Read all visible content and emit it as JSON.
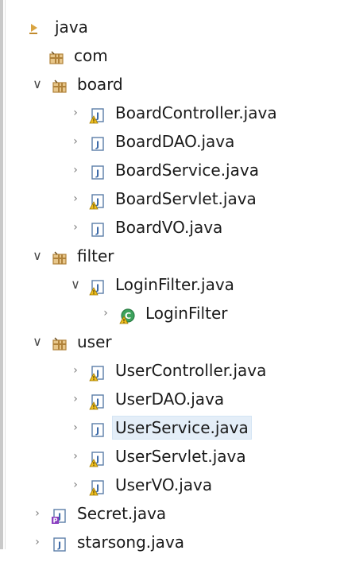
{
  "tree": {
    "items": [
      {
        "label": "java",
        "depth": 0,
        "icon": "source-folder-icon",
        "arrow": "none"
      },
      {
        "label": "com",
        "depth": 1,
        "icon": "package-icon",
        "arrow": "none"
      },
      {
        "label": "board",
        "depth": 2,
        "icon": "package-icon",
        "arrow": "down"
      },
      {
        "label": "BoardController.java",
        "depth": 3,
        "icon": "java-file-warning-icon",
        "arrow": "right"
      },
      {
        "label": "BoardDAO.java",
        "depth": 3,
        "icon": "java-file-icon",
        "arrow": "right"
      },
      {
        "label": "BoardService.java",
        "depth": 3,
        "icon": "java-file-icon",
        "arrow": "right"
      },
      {
        "label": "BoardServlet.java",
        "depth": 3,
        "icon": "java-file-warning-icon",
        "arrow": "right"
      },
      {
        "label": "BoardVO.java",
        "depth": 3,
        "icon": "java-file-icon",
        "arrow": "right"
      },
      {
        "label": "filter",
        "depth": 2,
        "icon": "package-icon",
        "arrow": "down"
      },
      {
        "label": "LoginFilter.java",
        "depth": 3,
        "icon": "java-file-warning-icon",
        "arrow": "down"
      },
      {
        "label": "LoginFilter",
        "depth": 4,
        "icon": "class-icon",
        "arrow": "right"
      },
      {
        "label": "user",
        "depth": 2,
        "icon": "package-icon",
        "arrow": "down"
      },
      {
        "label": "UserController.java",
        "depth": 3,
        "icon": "java-file-warning-icon",
        "arrow": "right"
      },
      {
        "label": "UserDAO.java",
        "depth": 3,
        "icon": "java-file-warning-icon",
        "arrow": "right"
      },
      {
        "label": "UserService.java",
        "depth": 3,
        "icon": "java-file-icon",
        "arrow": "right",
        "selected": true
      },
      {
        "label": "UserServlet.java",
        "depth": 3,
        "icon": "java-file-warning-icon",
        "arrow": "right"
      },
      {
        "label": "UserVO.java",
        "depth": 3,
        "icon": "java-file-warning-icon",
        "arrow": "right"
      },
      {
        "label": "Secret.java",
        "depth": 2,
        "icon": "java-file-error-icon",
        "arrow": "right"
      },
      {
        "label": "starsong.java",
        "depth": 2,
        "icon": "java-file-icon",
        "arrow": "right"
      }
    ]
  },
  "colors": {
    "package": "#c8a060",
    "java_file": "#4a7bb5",
    "warning": "#d4a017",
    "error": "#7a3fb0",
    "class": "#2f9e44",
    "selection": "#e4eef8"
  }
}
